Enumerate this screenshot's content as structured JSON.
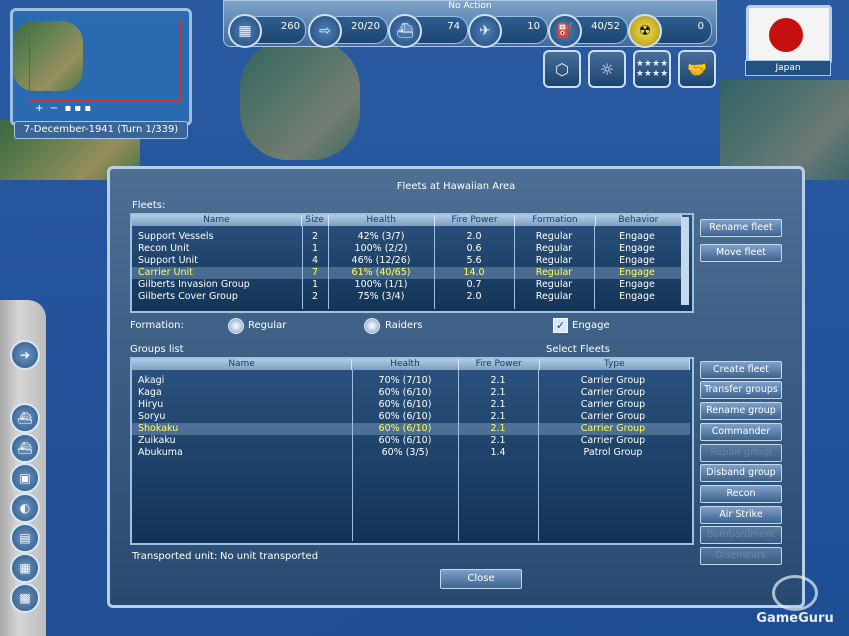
{
  "top": {
    "action_label": "No Action",
    "stats": [
      "260",
      "20/20",
      "74",
      "10",
      "40/52",
      "0"
    ]
  },
  "minimap": {
    "date": "7-December-1941 (Turn 1/339)"
  },
  "nation": {
    "country": "Japan"
  },
  "dialog": {
    "title": "Fleets at Hawaiian Area",
    "fleets_label": "Fleets:",
    "fleet_columns": [
      "Name",
      "Size",
      "Health",
      "Fire Power",
      "Formation",
      "Behavior"
    ],
    "fleets": [
      {
        "name": "Support Vessels",
        "size": "2",
        "health": "42% (3/7)",
        "fire": "2.0",
        "formation": "Regular",
        "behavior": "Engage"
      },
      {
        "name": "Recon Unit",
        "size": "1",
        "health": "100% (2/2)",
        "fire": "0.6",
        "formation": "Regular",
        "behavior": "Engage"
      },
      {
        "name": "Support Unit",
        "size": "4",
        "health": "46% (12/26)",
        "fire": "5.6",
        "formation": "Regular",
        "behavior": "Engage"
      },
      {
        "name": "Carrier Unit",
        "size": "7",
        "health": "61% (40/65)",
        "fire": "14.0",
        "formation": "Regular",
        "behavior": "Engage"
      },
      {
        "name": "Gilberts Invasion Group",
        "size": "1",
        "health": "100% (1/1)",
        "fire": "0.7",
        "formation": "Regular",
        "behavior": "Engage"
      },
      {
        "name": "Gilberts Cover Group",
        "size": "2",
        "health": "75% (3/4)",
        "fire": "2.0",
        "formation": "Regular",
        "behavior": "Engage"
      }
    ],
    "formation_label": "Formation:",
    "formation_regular": "Regular",
    "formation_raiders": "Raiders",
    "engage_label": "Engage",
    "groups_label": "Groups list",
    "select_fleets_label": "Select Fleets",
    "group_columns": [
      "Name",
      "Health",
      "Fire Power",
      "Type"
    ],
    "groups": [
      {
        "name": "Akagi",
        "health": "70% (7/10)",
        "fire": "2.1",
        "type": "Carrier Group"
      },
      {
        "name": "Kaga",
        "health": "60% (6/10)",
        "fire": "2.1",
        "type": "Carrier Group"
      },
      {
        "name": "Hiryu",
        "health": "60% (6/10)",
        "fire": "2.1",
        "type": "Carrier Group"
      },
      {
        "name": "Soryu",
        "health": "60% (6/10)",
        "fire": "2.1",
        "type": "Carrier Group"
      },
      {
        "name": "Shokaku",
        "health": "60% (6/10)",
        "fire": "2.1",
        "type": "Carrier Group"
      },
      {
        "name": "Zuikaku",
        "health": "60% (6/10)",
        "fire": "2.1",
        "type": "Carrier Group"
      },
      {
        "name": "Abukuma",
        "health": "60% (3/5)",
        "fire": "1.4",
        "type": "Patrol Group"
      }
    ],
    "fleet_buttons": [
      "Rename fleet",
      "Move fleet"
    ],
    "group_buttons": [
      "Create fleet",
      "Transfer groups",
      "Rename group",
      "Commander",
      "Repair group",
      "Disband group",
      "Recon",
      "Air Strike",
      "Bombardment",
      "Disembark"
    ],
    "transported_label": "Transported unit:",
    "transported_value": "No unit transported",
    "close_label": "Close"
  },
  "watermark": "GameGuru"
}
